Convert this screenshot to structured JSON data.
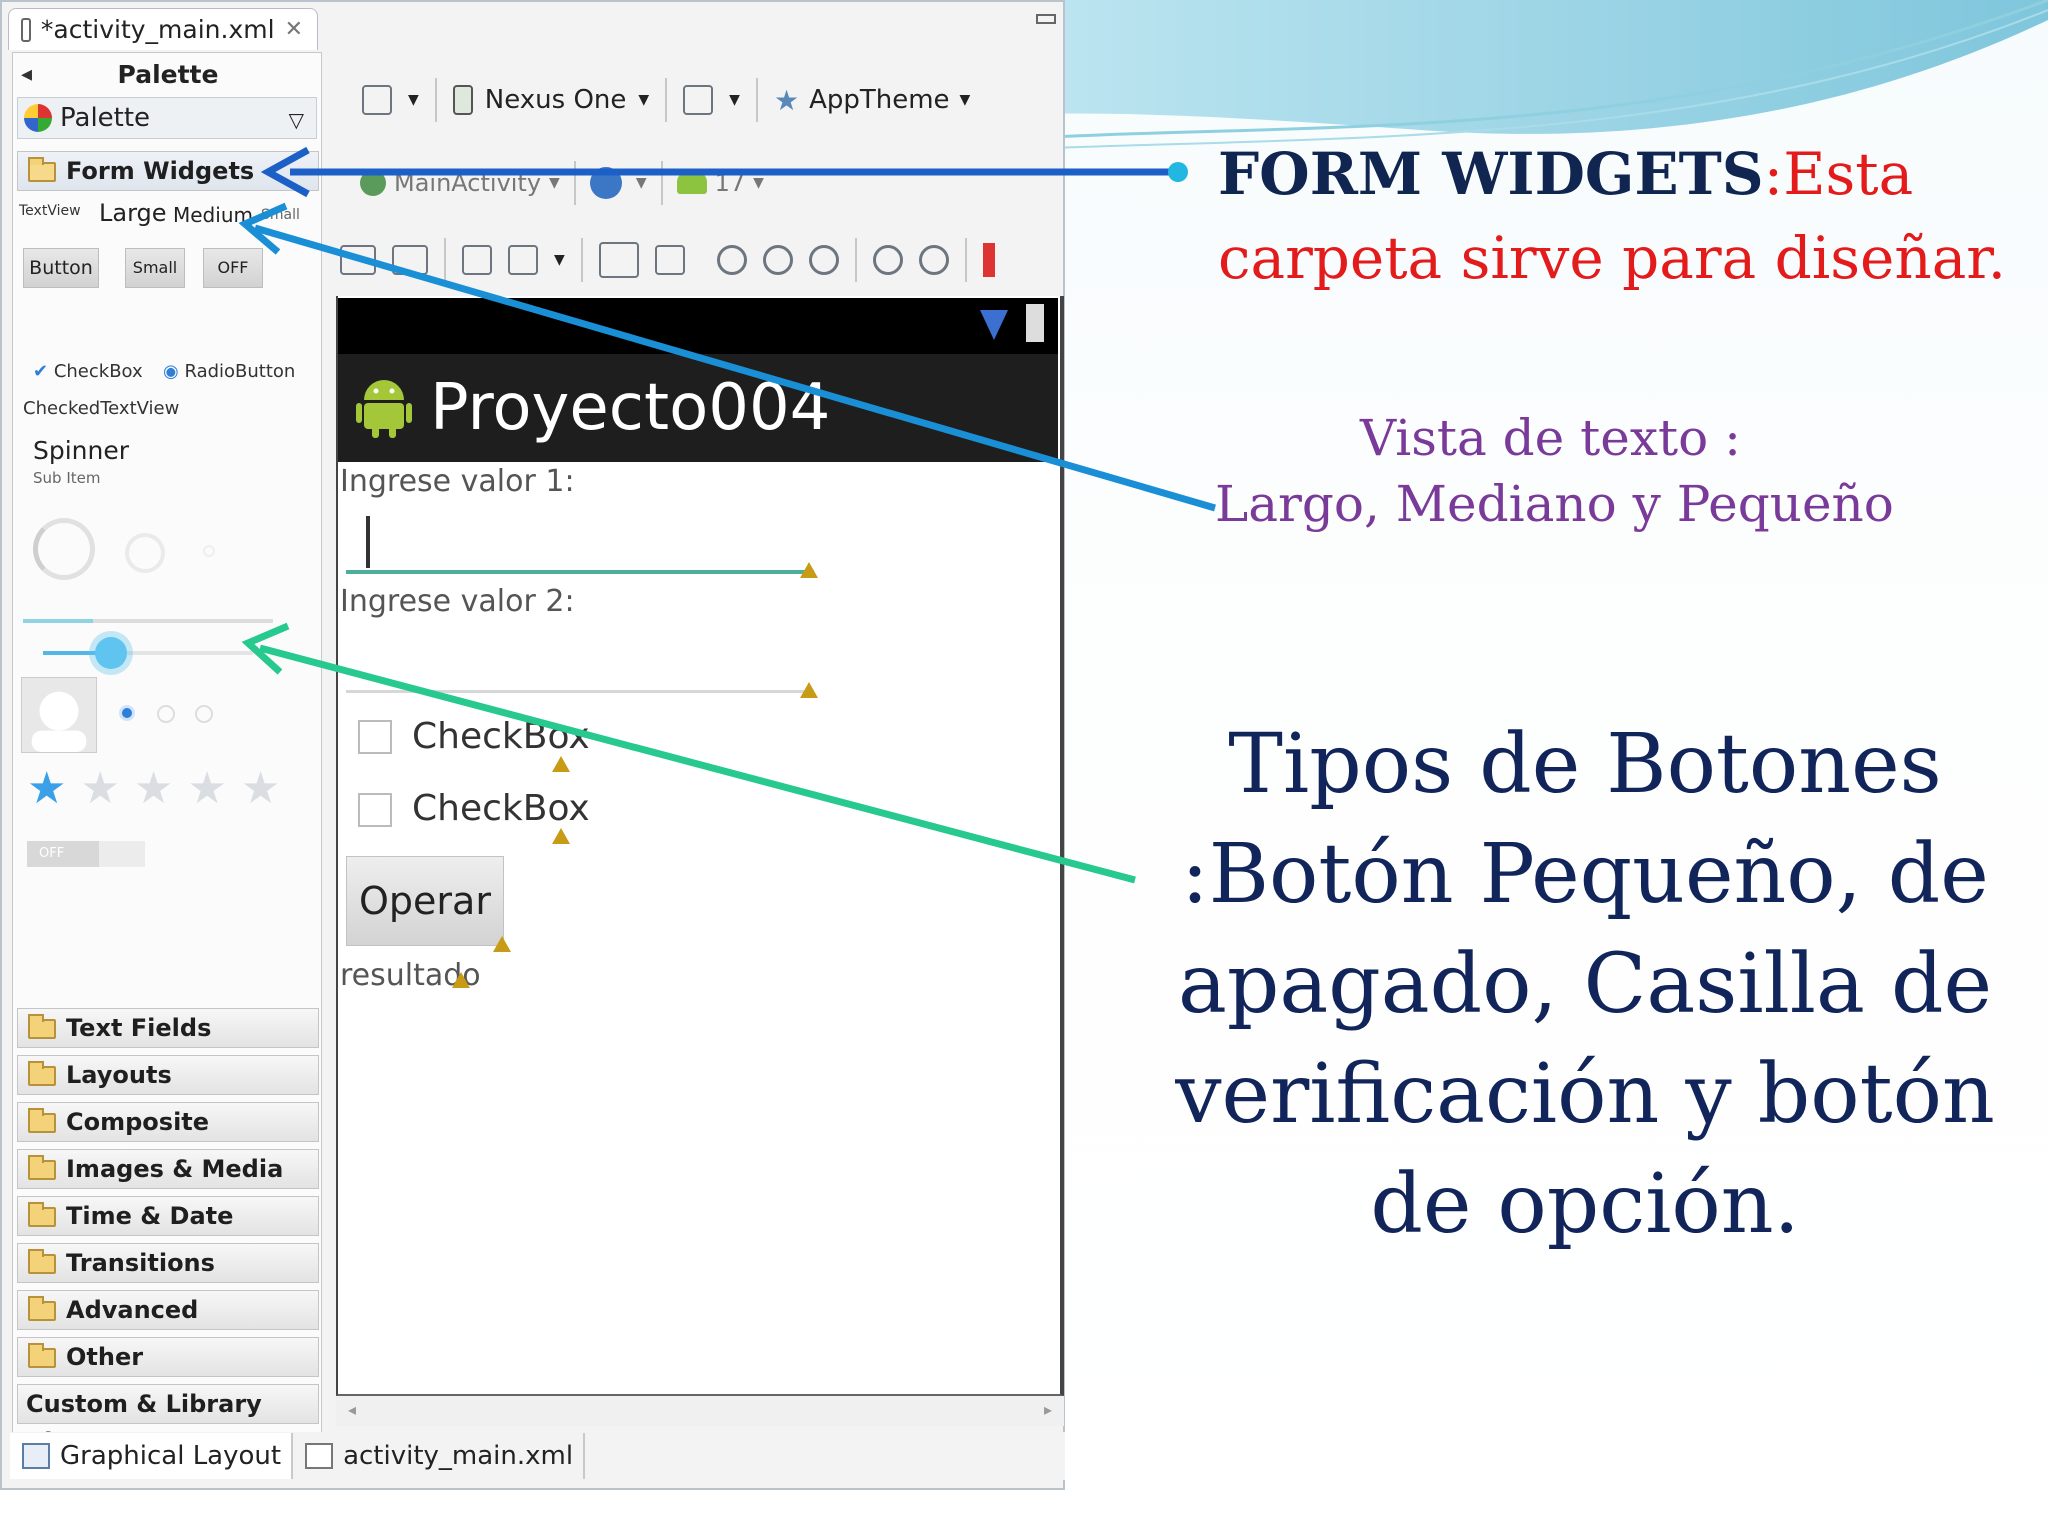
{
  "ide": {
    "editor_tab": "*activity_main.xml",
    "palette_title": "Palette",
    "palette_dropdown": "Palette",
    "form_widgets": "Form Widgets",
    "widgets": {
      "textview_label": "TextView",
      "large": "Large",
      "medium": "Medium",
      "small": "Small",
      "button": "Button",
      "small_button": "Small",
      "toggle_off": "OFF",
      "checkbox": "CheckBox",
      "radiobutton": "RadioButton",
      "checked_textview": "CheckedTextView",
      "spinner": "Spinner",
      "spinner_sub": "Sub Item",
      "switch_off": "OFF",
      "rating": 1
    },
    "categories": [
      "Text Fields",
      "Layouts",
      "Composite",
      "Images & Media",
      "Time & Date",
      "Transitions",
      "Advanced",
      "Other"
    ],
    "custom_views": "Custom & Library Views",
    "toolbar": {
      "device": "Nexus One",
      "theme": "AppTheme",
      "activity": "MainActivity",
      "api": "17"
    },
    "device_screen": {
      "app_title": "Proyecto004",
      "label1": "Ingrese valor 1:",
      "label2": "Ingrese valor 2:",
      "checkbox1": "CheckBox",
      "checkbox2": "CheckBox",
      "button": "Operar",
      "result": "resultado"
    },
    "bottom_tabs": [
      "Graphical Layout",
      "activity_main.xml"
    ]
  },
  "annotations": {
    "form_widgets_title": "FORM WIDGETS",
    "form_widgets_desc": ":Esta carpeta sirve para diseñar.",
    "textview_line1": "Vista de texto :",
    "textview_line2": "Largo, Mediano y Pequeño",
    "buttons_text": "Tipos de Botones :Botón Pequeño, de apagado, Casilla de verificación y botón de opción."
  },
  "colors": {
    "arrow_blue": "#1c5fc7",
    "arrow_light": "#1a8fd6",
    "arrow_green": "#27c98f",
    "title_navy": "#10254f",
    "red": "#e31b1b",
    "purple": "#7a3a9a"
  }
}
